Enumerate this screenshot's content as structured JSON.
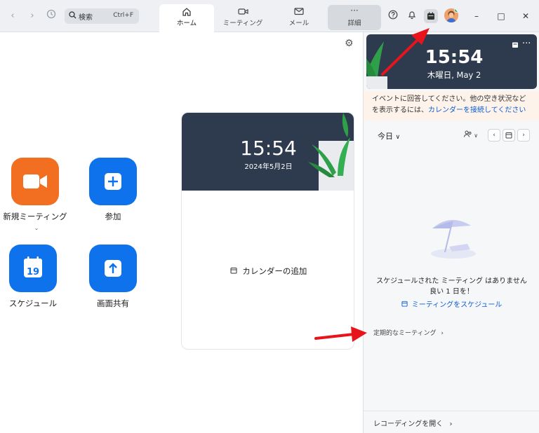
{
  "topbar": {
    "search_label": "検索",
    "search_shortcut": "Ctrl+F",
    "tabs": [
      {
        "label": "ホーム",
        "icon": "home-icon"
      },
      {
        "label": "ミーティング",
        "icon": "video-icon"
      },
      {
        "label": "メール",
        "icon": "mail-icon"
      },
      {
        "label": "詳細",
        "icon": "more-icon"
      }
    ],
    "icons": [
      "help-icon",
      "bell-icon",
      "calendar-icon",
      "avatar",
      "minimize-icon",
      "maximize-icon",
      "close-icon"
    ]
  },
  "home": {
    "actions": [
      {
        "label": "新規ミーティング",
        "icon": "video-camera-icon",
        "color": "#f26e21",
        "dropdown": true
      },
      {
        "label": "参加",
        "icon": "plus-icon",
        "color": "#0e72ed"
      },
      {
        "label": "スケジュール",
        "icon": "calendar-icon",
        "color": "#0e72ed",
        "day": "19"
      },
      {
        "label": "画面共有",
        "icon": "share-up-arrow-icon",
        "color": "#0e72ed"
      }
    ],
    "card": {
      "time": "15:54",
      "date": "2024年5月2日",
      "add_calendar": "カレンダーの追加"
    }
  },
  "right_panel": {
    "time": "15:54",
    "date": "木曜日, May 2",
    "notice_text": "イベントに回答してください。他の空き状況などを表示するには、",
    "notice_link": "カレンダーを接続してください",
    "today": "今日",
    "empty_line1": "スケジュールされた ミーティング はありません",
    "empty_line2": "良い 1 日を！",
    "schedule_link": "ミーティングをスケジュール",
    "recurring": "定期的なミーティング",
    "open_recordings": "レコーディングを開く"
  },
  "colors": {
    "accent": "#0e72ed",
    "orange": "#f26e21",
    "hero_bg": "#2e3b4e",
    "annotation_arrow": "#e8141b"
  }
}
